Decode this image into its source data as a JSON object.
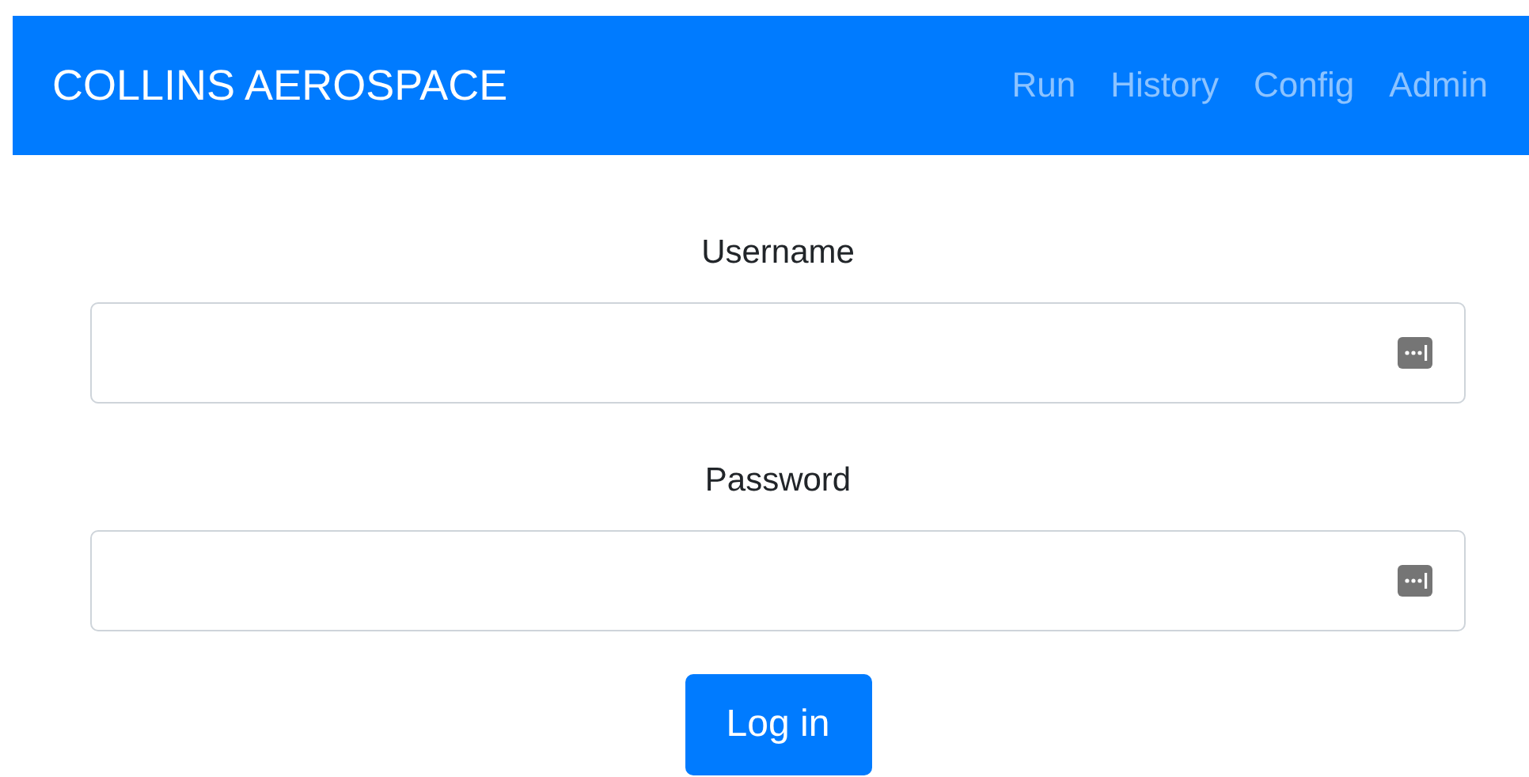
{
  "navbar": {
    "brand": "COLLINS AEROSPACE",
    "links": [
      {
        "label": "Run"
      },
      {
        "label": "History"
      },
      {
        "label": "Config"
      },
      {
        "label": "Admin"
      }
    ]
  },
  "form": {
    "fields": [
      {
        "label": "Username"
      },
      {
        "label": "Password"
      }
    ],
    "submit": "Log in"
  }
}
